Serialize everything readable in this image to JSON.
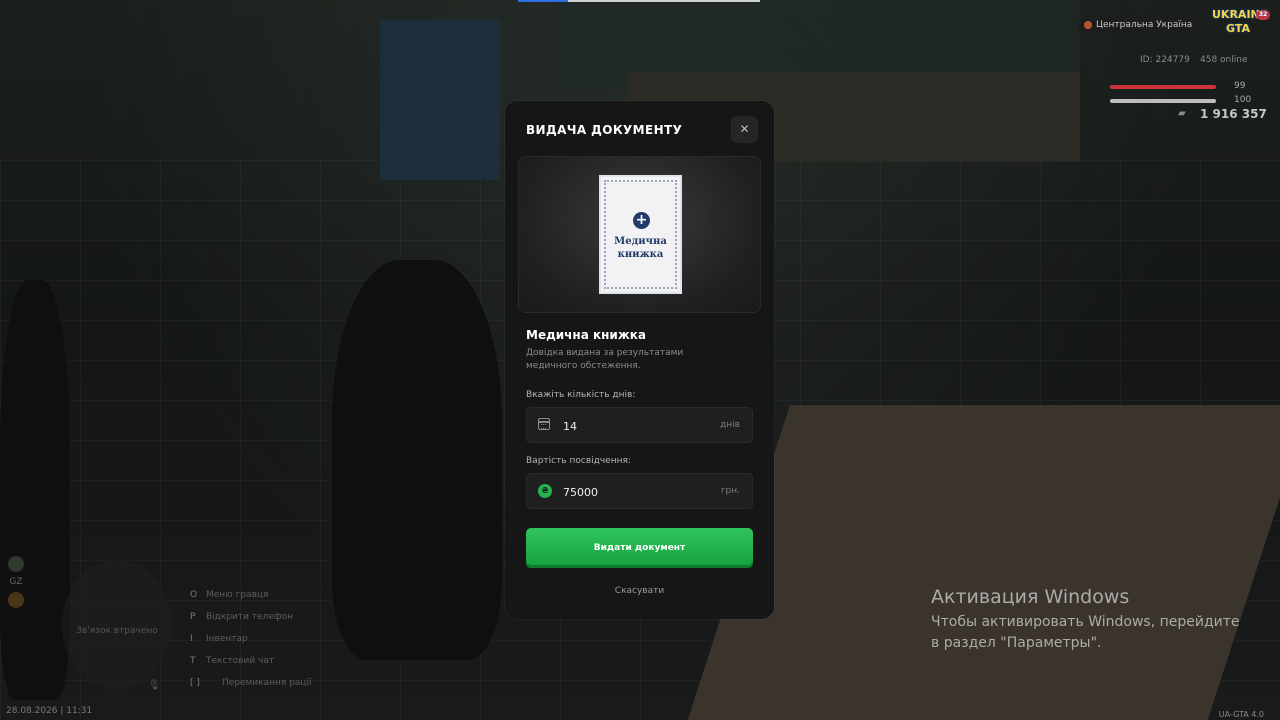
{
  "modal": {
    "title": "ВИДАЧА ДОКУМЕНТУ",
    "close_icon": "close-icon",
    "document_image": {
      "label_line1": "Медична",
      "label_line2": "книжка",
      "icon": "plus-icon"
    },
    "document_name": "Медична книжка",
    "document_description": "Довідка видана за результатами медичного обстеження.",
    "days_field": {
      "label": "Вкажіть кількість днів:",
      "value": "14",
      "unit": "днів",
      "icon": "calendar-icon"
    },
    "cost_field": {
      "label": "Вартість посвідчення:",
      "value": "75000",
      "unit": "грн.",
      "icon": "hryvnia-coin-icon",
      "icon_glyph": "₴"
    },
    "issue_button": "Видати документ",
    "cancel_button": "Скасувати"
  },
  "hud": {
    "region": "Центральна Україна",
    "logo_line1": "UKRAINE",
    "logo_line2": "GTA",
    "logo_badge": "32",
    "player_id": "ID: 224779",
    "online": "458 online",
    "health": "99",
    "armor": "100",
    "money": "1 916 357",
    "health_color": "#c9343a",
    "armor_color": "#bdbdbd",
    "date_time": "28.08.2026 | 11:31",
    "version": "UA-GTA 4.0",
    "minimap_text": "Зв'язок втрачено",
    "hotkeys": [
      {
        "key": "O",
        "label": "Меню гравця"
      },
      {
        "key": "P",
        "label": "Відкрити телефон"
      },
      {
        "key": "I",
        "label": "Інвентар"
      },
      {
        "key": "T",
        "label": "Текстовий чат"
      },
      {
        "key": "[ ]",
        "label": "Перемикання рації"
      }
    ],
    "side_icons": [
      "GZ"
    ]
  },
  "windows_activation": {
    "title": "Активация Windows",
    "text": "Чтобы активировать Windows, перейдите в раздел \"Параметры\"."
  },
  "colors": {
    "accent_green": "#1fae4a",
    "modal_bg": "#161616",
    "field_bg": "#1f1f1f"
  }
}
